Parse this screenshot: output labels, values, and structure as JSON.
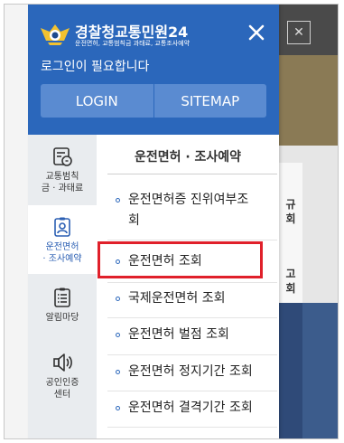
{
  "brand": {
    "title": "경찰청교통민원24",
    "subtitle": "운전면허, 교통범칙금 과태료, 교통조사예약"
  },
  "header": {
    "login_message": "로그인이 필요합니다",
    "login_button": "LOGIN",
    "sitemap_button": "SITEMAP"
  },
  "sidebar": {
    "items": [
      {
        "label_line1": "교통범칙",
        "label_line2": "금 · 과태료",
        "icon": "fine-receipt-icon"
      },
      {
        "label_line1": "운전면허",
        "label_line2": "· 조사예약",
        "icon": "license-icon"
      },
      {
        "label_line1": "알림마당",
        "label_line2": "",
        "icon": "notice-board-icon"
      },
      {
        "label_line1": "공인인증",
        "label_line2": "센터",
        "icon": "speaker-icon"
      }
    ],
    "active_index": 1
  },
  "content": {
    "title": "운전면허 · 조사예약",
    "items": [
      {
        "line1": "운전면허증 진위여부조",
        "line2": "회"
      },
      {
        "line1": "운전면허 조회",
        "line2": ""
      },
      {
        "line1": "국제운전면허 조회",
        "line2": ""
      },
      {
        "line1": "운전면허 벌점 조회",
        "line2": ""
      },
      {
        "line1": "운전면허 정지기간 조회",
        "line2": ""
      },
      {
        "line1": "운전면허 결격기간 조회",
        "line2": ""
      }
    ],
    "highlighted_item_index": 1
  },
  "background": {
    "card_top": [
      "규",
      "회"
    ],
    "card_bottom": [
      "고",
      "회"
    ]
  },
  "colors": {
    "header_blue": "#2b67bb",
    "button_blue": "#5a8bd1",
    "highlight_red": "#e0202a"
  }
}
